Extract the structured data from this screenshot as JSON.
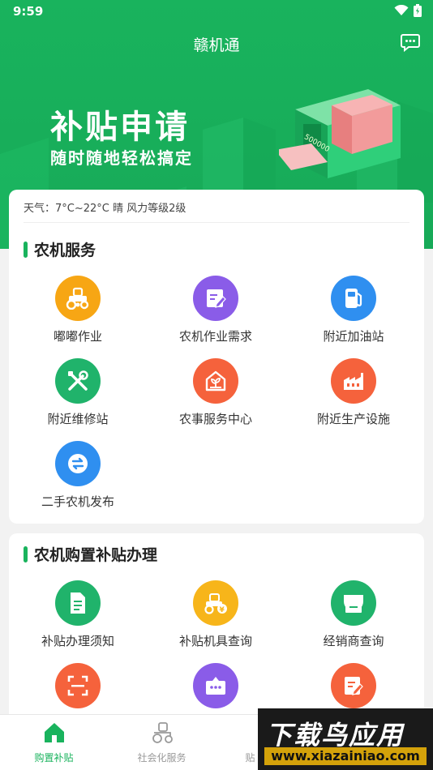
{
  "status_bar": {
    "time": "9:59"
  },
  "header": {
    "app_title": "赣机通"
  },
  "banner": {
    "title": "补贴申请",
    "subtitle": "随时随地轻松搞定",
    "cash_label": "500000"
  },
  "weather": {
    "text": "天气：7°C~22°C 晴 风力等级2级"
  },
  "services": {
    "title": "农机服务",
    "items": [
      {
        "label": "嘟嘟作业",
        "icon": "tractor-icon",
        "color": "#f7a614"
      },
      {
        "label": "农机作业需求",
        "icon": "document-edit-icon",
        "color": "#8a5ce8"
      },
      {
        "label": "附近加油站",
        "icon": "fuel-pump-icon",
        "color": "#2f8ff0"
      },
      {
        "label": "附近维修站",
        "icon": "tools-icon",
        "color": "#20b36b"
      },
      {
        "label": "农事服务中心",
        "icon": "farm-house-icon",
        "color": "#f5623c"
      },
      {
        "label": "附近生产设施",
        "icon": "factory-icon",
        "color": "#f5623c"
      },
      {
        "label": "二手农机发布",
        "icon": "exchange-icon",
        "color": "#2f8ff0"
      }
    ]
  },
  "subsidy": {
    "title": "农机购置补贴办理",
    "items": [
      {
        "label": "补贴办理须知",
        "icon": "notice-document-icon",
        "color": "#20b36b"
      },
      {
        "label": "补贴机具查询",
        "icon": "machine-search-icon",
        "color": "#f7b51a"
      },
      {
        "label": "经销商查询",
        "icon": "store-icon",
        "color": "#20b36b"
      },
      {
        "label": "",
        "icon": "scan-icon",
        "color": "#f5623c"
      },
      {
        "label": "",
        "icon": "chat-box-icon",
        "color": "#8a5ce8"
      },
      {
        "label": "",
        "icon": "form-edit-icon",
        "color": "#f5623c"
      }
    ]
  },
  "tabbar": {
    "tabs": [
      {
        "label": "购置补贴",
        "icon": "home-icon",
        "active": true
      },
      {
        "label": "社会化服务",
        "icon": "tractor-outline-icon",
        "active": false
      },
      {
        "label": "贴",
        "icon": "",
        "active": false
      }
    ]
  },
  "watermark": {
    "main": "下载鸟应用",
    "url": "www.xiazainiao.com"
  }
}
